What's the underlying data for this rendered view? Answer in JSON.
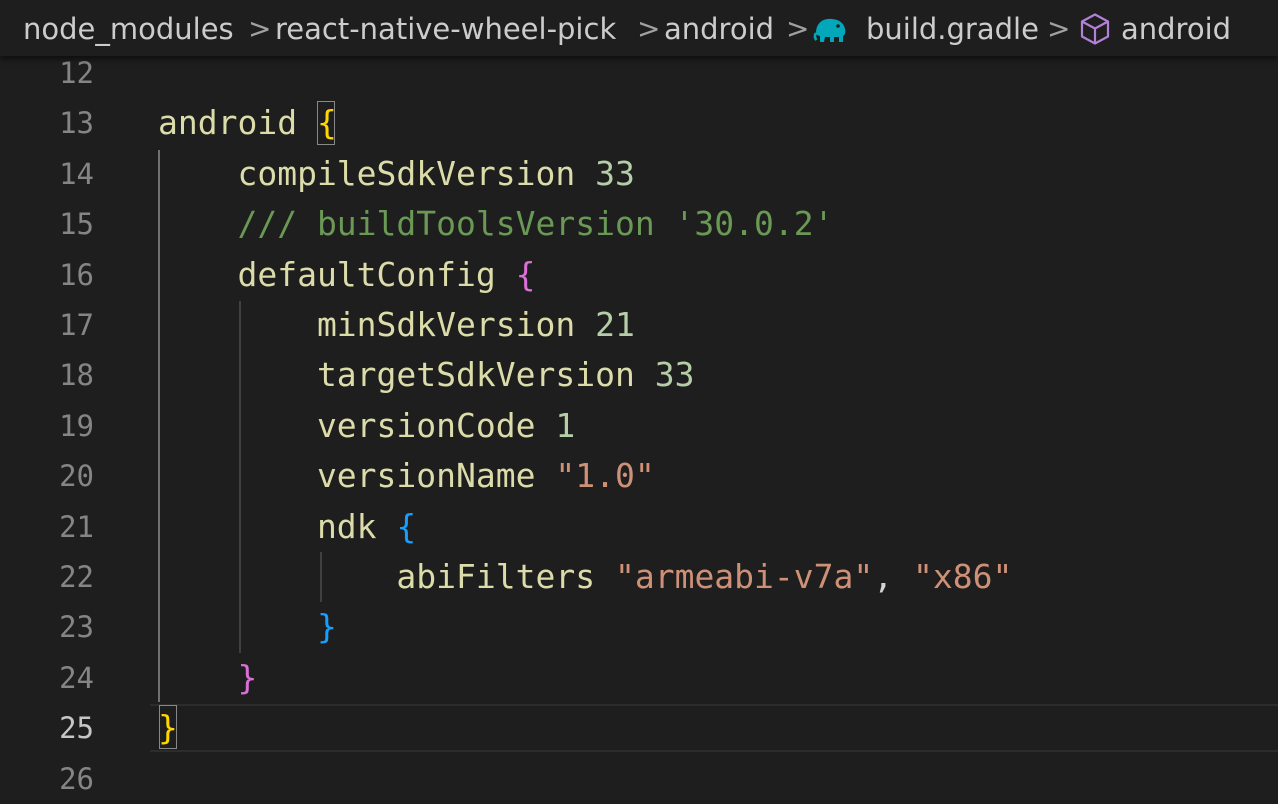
{
  "breadcrumb": {
    "items": [
      "node_modules",
      "react-native-wheel-pick",
      "android",
      "build.gradle",
      "android"
    ],
    "separator": ">",
    "icons": [
      "gradle-elephant-icon",
      "symbol-module-icon"
    ]
  },
  "colors": {
    "background": "#1e1e1e",
    "line_number": "#858585",
    "line_number_active": "#c6c6c6",
    "identifier": "#dcdcaa",
    "number": "#b5cea8",
    "string": "#ce9178",
    "comment": "#6a9955",
    "bracket_level1": "#ffd700",
    "bracket_level2": "#da70d6",
    "bracket_level3": "#179fff",
    "gradle_icon": "#02a7b9",
    "module_icon": "#b180d7"
  },
  "editor": {
    "active_line": "25",
    "lines": [
      {
        "n": "12",
        "tokens": []
      },
      {
        "n": "13",
        "tokens": [
          {
            "t": "android",
            "c": "tok-plain"
          },
          {
            "t": " ",
            "c": "tok-punct"
          },
          {
            "t": "{",
            "c": "brace-gold"
          }
        ]
      },
      {
        "n": "14",
        "tokens": [
          {
            "t": "    compileSdkVersion ",
            "c": "tok-plain"
          },
          {
            "t": "33",
            "c": "tok-num"
          }
        ]
      },
      {
        "n": "15",
        "tokens": [
          {
            "t": "    /// buildToolsVersion '30.0.2'",
            "c": "tok-comment"
          }
        ]
      },
      {
        "n": "16",
        "tokens": [
          {
            "t": "    defaultConfig ",
            "c": "tok-plain"
          },
          {
            "t": "{",
            "c": "brace-pink"
          }
        ]
      },
      {
        "n": "17",
        "tokens": [
          {
            "t": "        minSdkVersion ",
            "c": "tok-plain"
          },
          {
            "t": "21",
            "c": "tok-num"
          }
        ]
      },
      {
        "n": "18",
        "tokens": [
          {
            "t": "        targetSdkVersion ",
            "c": "tok-plain"
          },
          {
            "t": "33",
            "c": "tok-num"
          }
        ]
      },
      {
        "n": "19",
        "tokens": [
          {
            "t": "        versionCode ",
            "c": "tok-plain"
          },
          {
            "t": "1",
            "c": "tok-num"
          }
        ]
      },
      {
        "n": "20",
        "tokens": [
          {
            "t": "        versionName ",
            "c": "tok-plain"
          },
          {
            "t": "\"1.0\"",
            "c": "tok-str"
          }
        ]
      },
      {
        "n": "21",
        "tokens": [
          {
            "t": "        ndk ",
            "c": "tok-plain"
          },
          {
            "t": "{",
            "c": "brace-blue"
          }
        ]
      },
      {
        "n": "22",
        "tokens": [
          {
            "t": "            abiFilters ",
            "c": "tok-plain"
          },
          {
            "t": "\"armeabi-v7a\"",
            "c": "tok-str"
          },
          {
            "t": ", ",
            "c": "tok-punct"
          },
          {
            "t": "\"x86\"",
            "c": "tok-str"
          }
        ]
      },
      {
        "n": "23",
        "tokens": [
          {
            "t": "        ",
            "c": "tok-plain"
          },
          {
            "t": "}",
            "c": "brace-blue"
          }
        ]
      },
      {
        "n": "24",
        "tokens": [
          {
            "t": "    ",
            "c": "tok-plain"
          },
          {
            "t": "}",
            "c": "brace-pink"
          }
        ]
      },
      {
        "n": "25",
        "tokens": [
          {
            "t": "}",
            "c": "brace-gold"
          }
        ]
      },
      {
        "n": "26",
        "tokens": []
      }
    ]
  }
}
